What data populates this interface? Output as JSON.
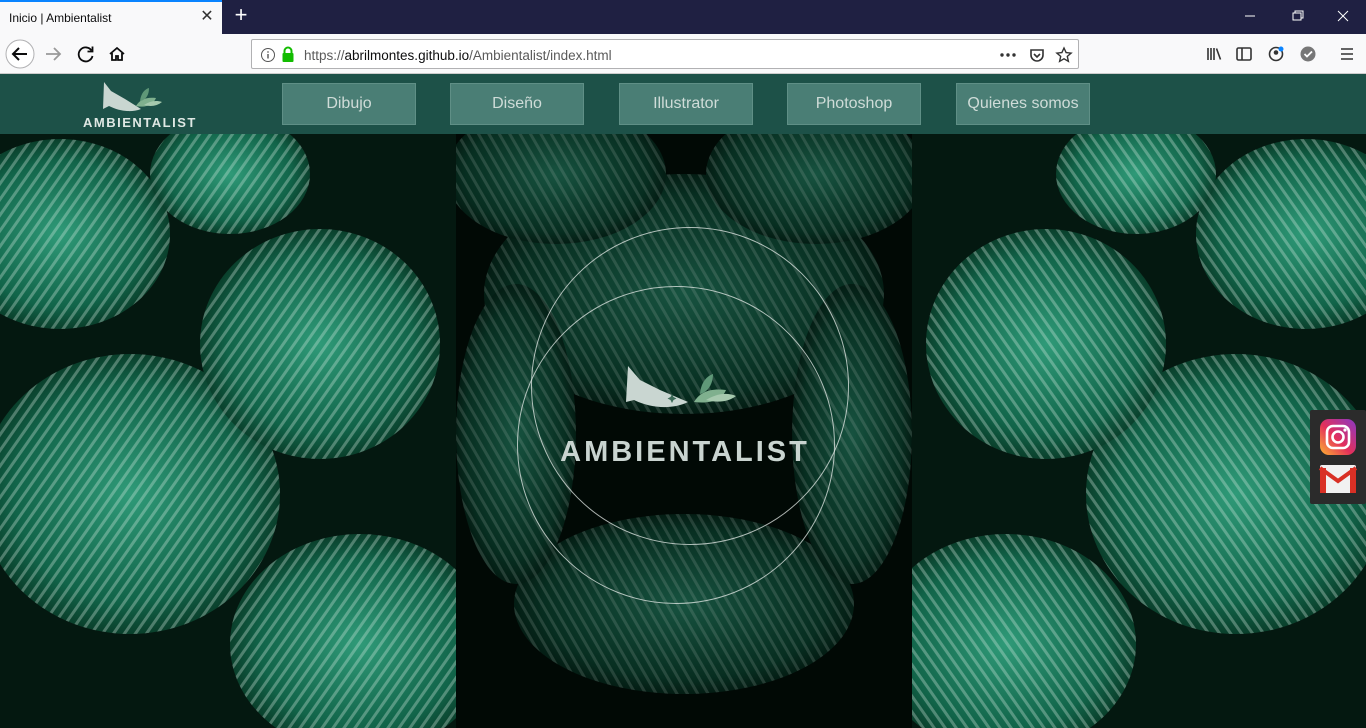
{
  "browser": {
    "tab_title": "Inicio | Ambientalist",
    "url_prefix": "https://",
    "url_host": "abrilmontes.github.io",
    "url_path": "/Ambientalist/index.html",
    "accent_color": "#0a84ff"
  },
  "site": {
    "logo_text": "AMBIENTALIST",
    "nav_items": [
      "Dibujo",
      "Diseño",
      "Illustrator",
      "Photoshop",
      "Quienes somos"
    ],
    "hero_title": "AMBIENTALIST",
    "nav_color": "#1d5148",
    "button_color": "#4a7e75"
  },
  "social": {
    "items": [
      "instagram-icon",
      "gmail-icon"
    ]
  }
}
